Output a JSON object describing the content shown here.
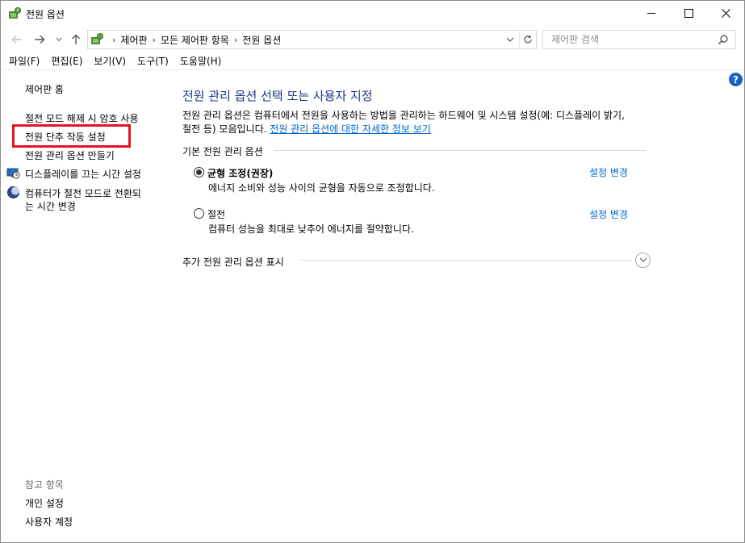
{
  "window": {
    "title": "전원 옵션",
    "icon": "power-options-icon"
  },
  "nav": {
    "back_icon": "back-arrow-icon",
    "forward_icon": "forward-arrow-icon",
    "recent_icon": "chevron-down-icon",
    "up_icon": "up-arrow-icon"
  },
  "address": {
    "crumbs": [
      "제어판",
      "모든 제어판 항목",
      "전원 옵션"
    ]
  },
  "search": {
    "placeholder": "제어판 검색"
  },
  "menu": {
    "items": [
      "파일(F)",
      "편집(E)",
      "보기(V)",
      "도구(T)",
      "도움말(H)"
    ]
  },
  "left": {
    "home": "제어판 홈",
    "links": [
      "절전 모드 해제 시 암호 사용",
      "전원 단추 작동 설정",
      "전원 관리 옵션 만들기",
      "디스플레이를 끄는 시간 설정",
      "컴퓨터가 절전 모드로 전환되",
      "는 시간 변경"
    ],
    "see_also_title": "참고 항목",
    "see_also": [
      "개인 설정",
      "사용자 계정"
    ]
  },
  "main": {
    "title": "전원 관리 옵션 선택 또는 사용자 지정",
    "desc_line1": "전원 관리 옵션은 컴퓨터에서 전원을 사용하는 방법을 관리하는 하드웨어 및 시스템 설정(예: 디스플레이 밝기,",
    "desc_line2_prefix": "절전 등) 모음입니다.",
    "desc_link": "전원 관리 옵션에 대한 자세한 정보 보기",
    "section_label": "기본 전원 관리 옵션",
    "plans": [
      {
        "name": "균형 조정(권장)",
        "desc": "에너지 소비와 성능 사이의 균형을 자동으로 조정합니다.",
        "link": "설정 변경",
        "selected": true
      },
      {
        "name": "절전",
        "desc": "컴퓨터 성능을 최대로 낮추어 에너지를 절약합니다.",
        "link": "설정 변경",
        "selected": false
      }
    ],
    "more_label": "추가 전원 관리 옵션 표시"
  },
  "help": "?",
  "colors": {
    "title_blue": "#1e3287",
    "link_blue": "#0066cc",
    "highlight_red": "#e81123",
    "help_blue": "#1764c0"
  }
}
